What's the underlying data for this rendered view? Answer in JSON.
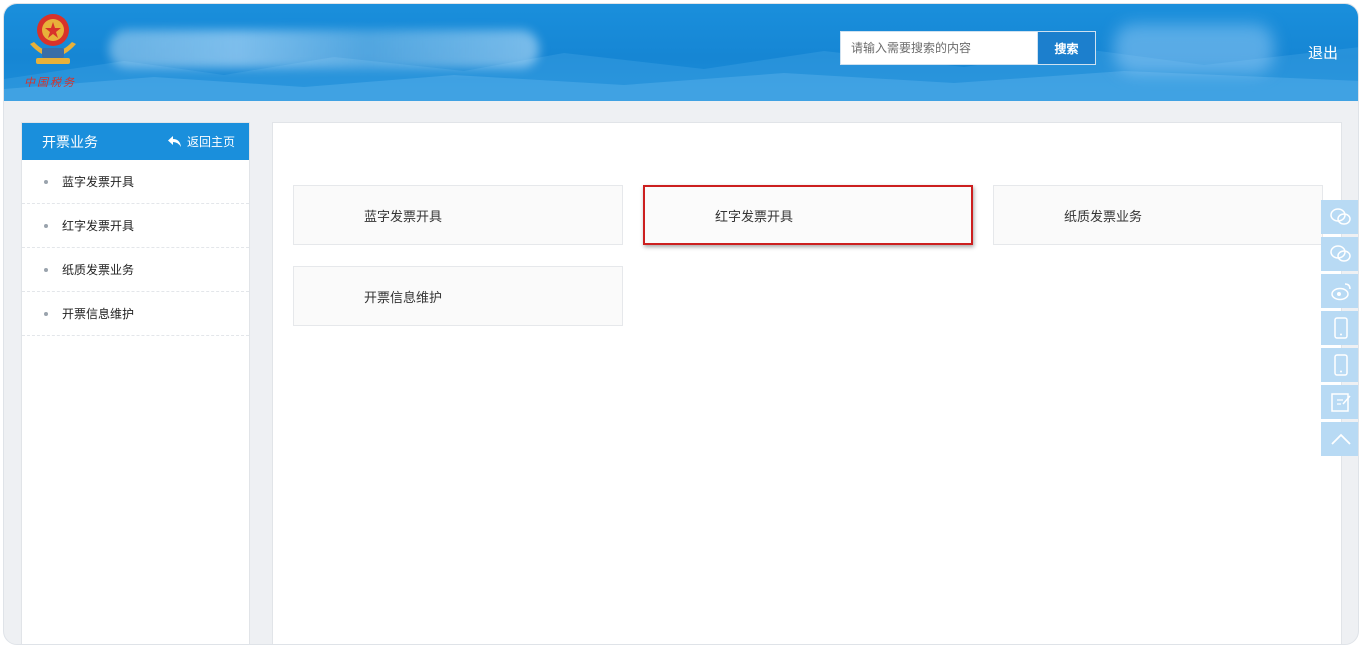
{
  "header": {
    "emblem_text": "中国税务",
    "search_placeholder": "请输入需要搜索的内容",
    "search_button": "搜索",
    "logout": "退出"
  },
  "sidebar": {
    "title": "开票业务",
    "back_label": "返回主页",
    "items": [
      {
        "label": "蓝字发票开具"
      },
      {
        "label": "红字发票开具"
      },
      {
        "label": "纸质发票业务"
      },
      {
        "label": "开票信息维护"
      }
    ]
  },
  "main": {
    "cards": [
      {
        "label": "蓝字发票开具",
        "highlighted": false
      },
      {
        "label": "红字发票开具",
        "highlighted": true
      },
      {
        "label": "纸质发票业务",
        "highlighted": false
      },
      {
        "label": "开票信息维护",
        "highlighted": false
      }
    ]
  },
  "toolbar": {
    "tools": [
      "wechat-icon",
      "wechat-icon",
      "weibo-icon",
      "mobile-icon",
      "mobile-icon",
      "edit-icon",
      "back-to-top-icon"
    ]
  },
  "colors": {
    "header_blue": "#1a8fdc",
    "highlight_red": "#cc1f1f",
    "tool_bg": "#b8daf4"
  }
}
